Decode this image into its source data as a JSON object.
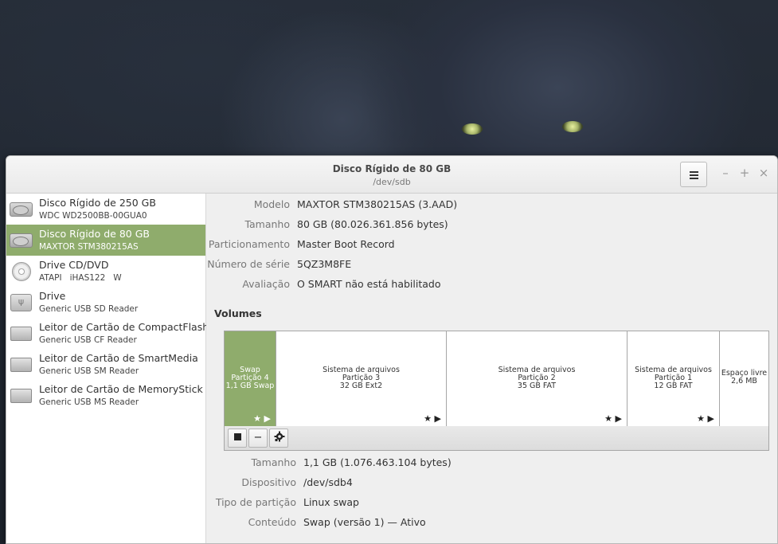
{
  "window": {
    "title": "Disco Rígido de 80 GB",
    "subtitle": "/dev/sdb",
    "menu_icon": "hamburger-menu-icon",
    "minimize": "–",
    "maximize": "+",
    "close": "×"
  },
  "sidebar": {
    "items": [
      {
        "name": "Disco Rígido de 250 GB",
        "sub": "WDC WD2500BB-00GUA0",
        "icon": "hdd-icon"
      },
      {
        "name": "Disco Rígido de 80 GB",
        "sub": "MAXTOR STM380215AS",
        "icon": "hdd-icon"
      },
      {
        "name": "Drive CD/DVD",
        "sub": "ATAPI   iHAS122   W",
        "icon": "cd-icon"
      },
      {
        "name": "Drive",
        "sub": "Generic USB SD Reader",
        "icon": "usb-icon"
      },
      {
        "name": "Leitor de Cartão de CompactFlash",
        "sub": "Generic USB CF Reader",
        "icon": "card-icon"
      },
      {
        "name": "Leitor de Cartão de SmartMedia",
        "sub": "Generic USB SM Reader",
        "icon": "card-icon"
      },
      {
        "name": "Leitor de Cartão de MemoryStick",
        "sub": "Generic USB MS Reader",
        "icon": "card-icon"
      }
    ],
    "selected_index": 1
  },
  "disk": {
    "model_key": "Modelo",
    "model_val": "MAXTOR STM380215AS (3.AAD)",
    "size_key": "Tamanho",
    "size_val": "80 GB (80.026.361.856 bytes)",
    "part_key": "Particionamento",
    "part_val": "Master Boot Record",
    "serial_key": "Número de série",
    "serial_val": "5QZ3M8FE",
    "rating_key": "Avaliação",
    "rating_val": "O SMART não está habilitado"
  },
  "volumes": {
    "title": "Volumes",
    "segments": [
      {
        "l1": "Swap",
        "l2": "Partição 4",
        "l3": "1,1 GB Swap"
      },
      {
        "l1": "Sistema de arquivos",
        "l2": "Partição 3",
        "l3": "32 GB Ext2"
      },
      {
        "l1": "Sistema de arquivos",
        "l2": "Partição 2",
        "l3": "35 GB FAT"
      },
      {
        "l1": "Sistema de arquivos",
        "l2": "Partição 1",
        "l3": "12 GB FAT"
      },
      {
        "l1": "Espaço livre",
        "l2": "2,6 MB",
        "l3": ""
      }
    ],
    "segment_icons": "★ ▶"
  },
  "toolbar": {
    "stop_icon": "stop-icon",
    "minus_label": "−",
    "gear_icon": "gear-icon"
  },
  "partition": {
    "size_key": "Tamanho",
    "size_val": "1,1 GB (1.076.463.104 bytes)",
    "device_key": "Dispositivo",
    "device_val": "/dev/sdb4",
    "type_key": "Tipo de partição",
    "type_val": "Linux swap",
    "content_key": "Conteúdo",
    "content_val": "Swap (versão 1) — Ativo"
  }
}
